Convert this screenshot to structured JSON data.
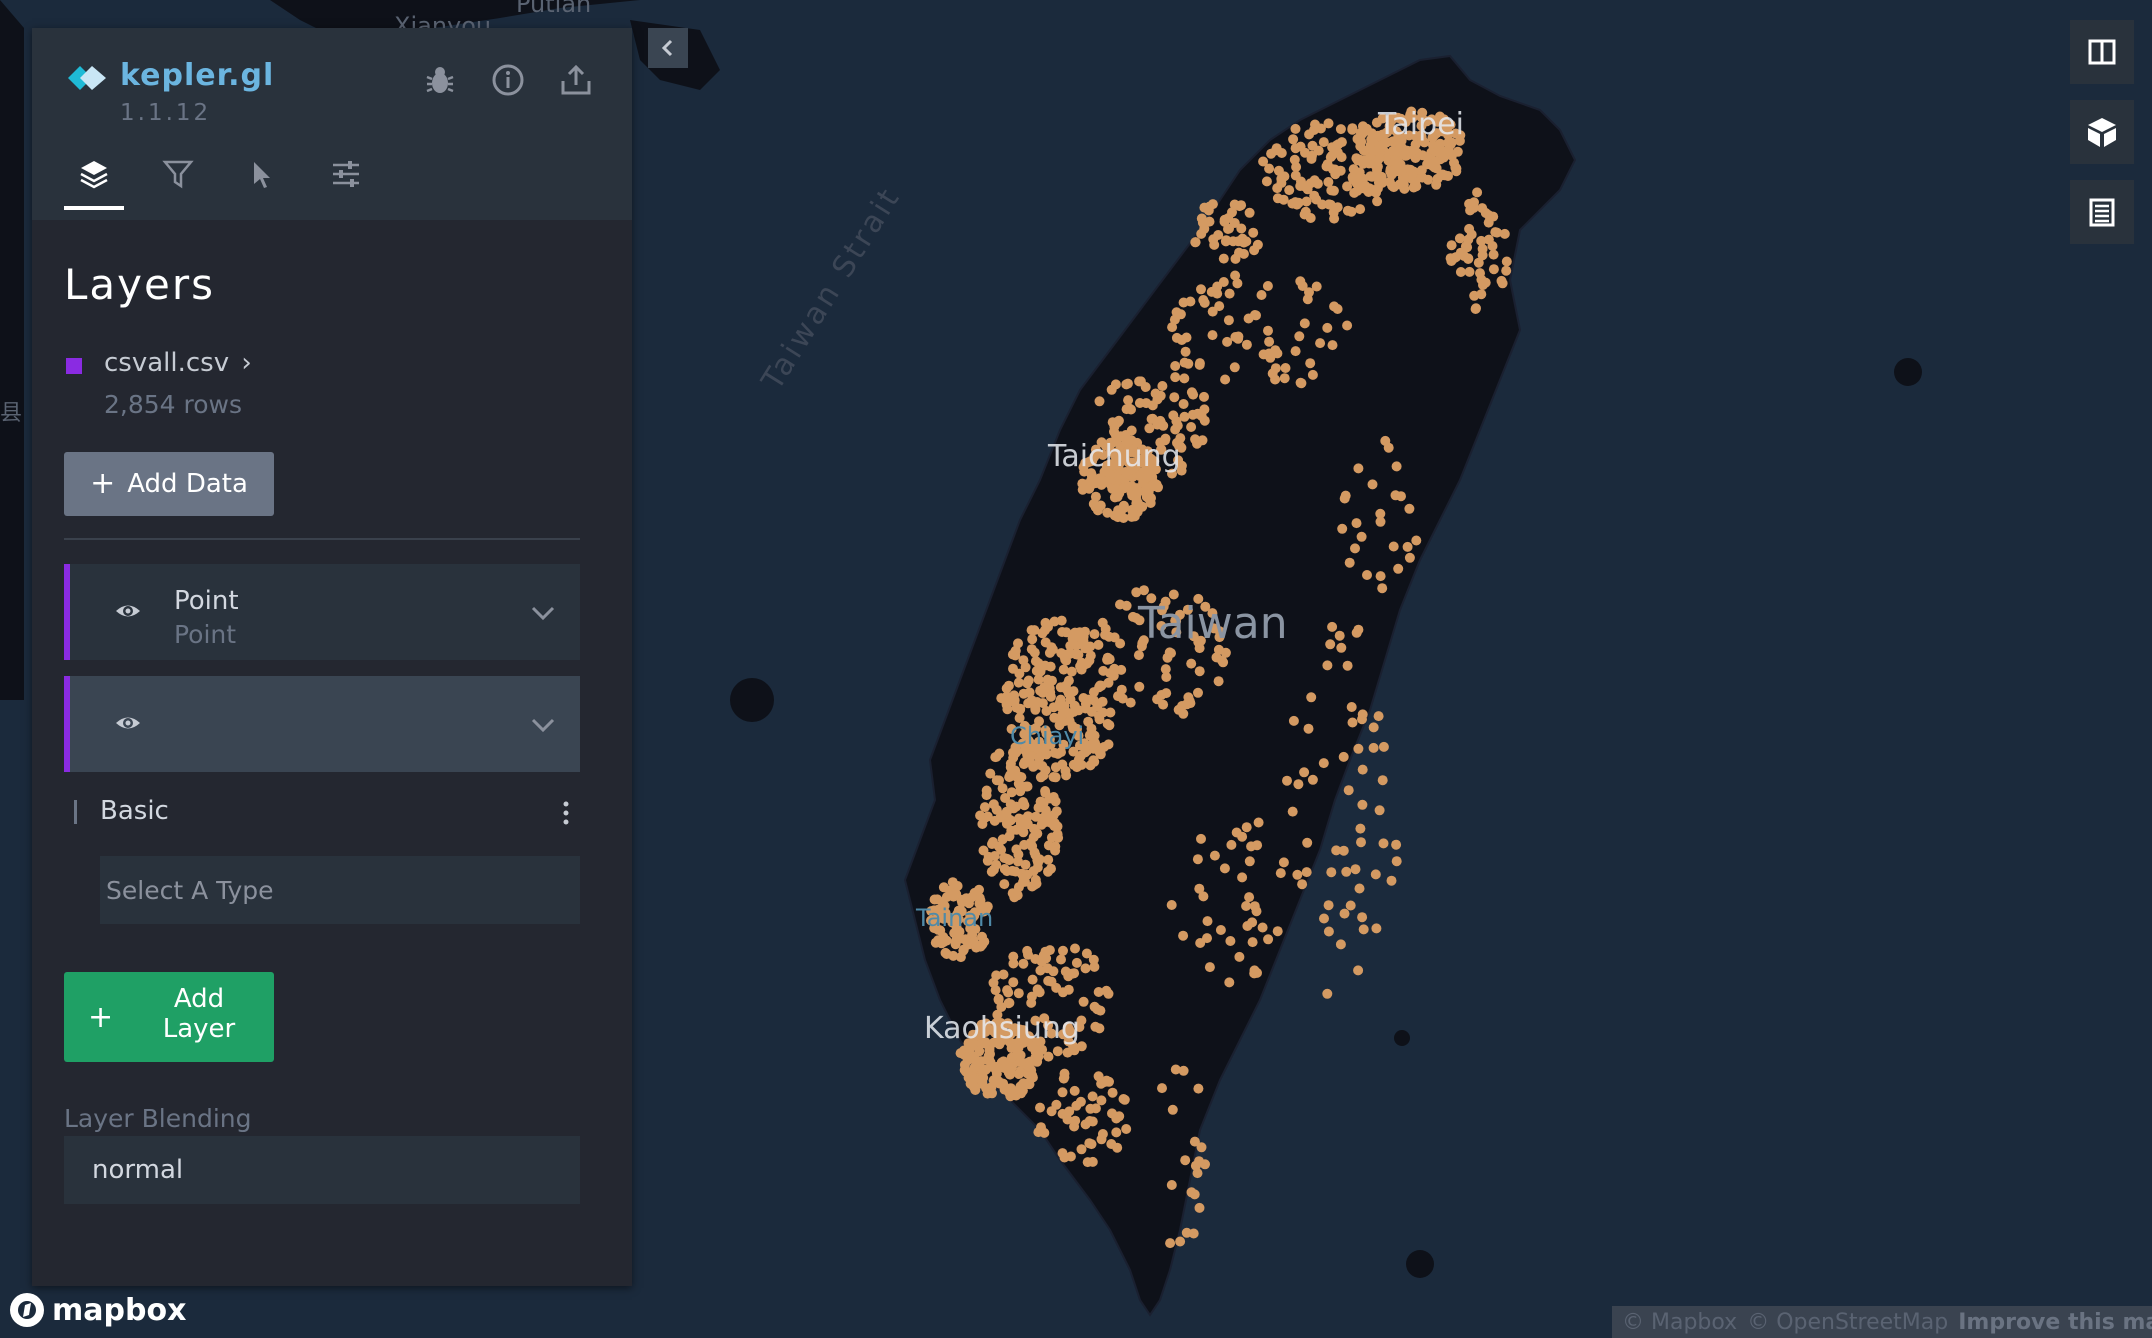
{
  "app": {
    "name": "kepler.gl",
    "version": "1.1.12"
  },
  "header_icons": [
    "bug-icon",
    "info-icon",
    "share-icon"
  ],
  "tabs": [
    {
      "name": "layers",
      "icon": "layers-icon",
      "active": true
    },
    {
      "name": "filters",
      "icon": "funnel-icon",
      "active": false
    },
    {
      "name": "interactions",
      "icon": "cursor-icon",
      "active": false
    },
    {
      "name": "map-style",
      "icon": "sliders-icon",
      "active": false
    }
  ],
  "panel": {
    "title": "Layers",
    "dataset": {
      "name": "csvall.csv",
      "chevron": "›",
      "rows": "2,854 rows",
      "color": "#8a2be2"
    },
    "add_data": "Add Data",
    "layers": [
      {
        "title": "Point",
        "subtitle": "Point"
      },
      {
        "title": "",
        "subtitle": ""
      }
    ],
    "config": {
      "label": "Basic",
      "type_placeholder": "Select A Type"
    },
    "add_layer": "Add Layer",
    "blending_label": "Layer Blending",
    "blending_value": "normal"
  },
  "map": {
    "labels": {
      "taiwan": "Taiwan",
      "strait": "Taiwan Strait",
      "taipei": "Taipei",
      "taichung": "Taichung",
      "chiayi": "Chiayi",
      "tainan": "Tainan",
      "kaohsiung": "Kaohsiung",
      "putian": "Putian",
      "xianyou": "Xianyou",
      "county": "县"
    },
    "point_color": "#d49a62",
    "land_color": "#0e1119",
    "water_color": "#1b2a3c"
  },
  "map_controls": [
    "split-map-icon",
    "3d-view-icon",
    "legend-icon"
  ],
  "footer": {
    "logo": "mapbox",
    "attribution": [
      "© Mapbox",
      "© OpenStreetMap",
      "Improve this map"
    ]
  }
}
